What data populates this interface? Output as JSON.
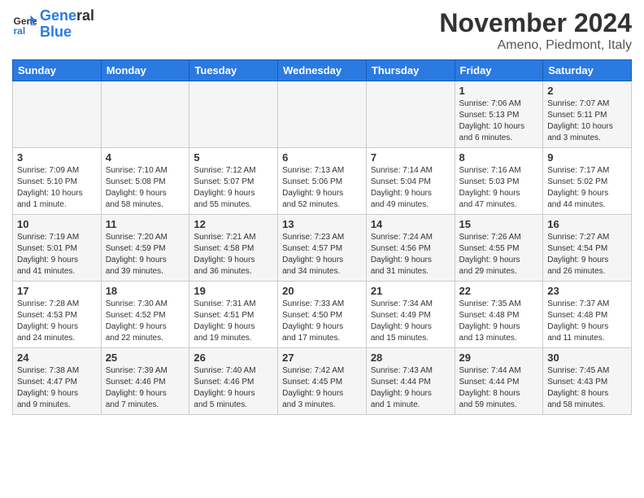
{
  "logo": {
    "line1": "General",
    "line2": "Blue"
  },
  "title": "November 2024",
  "location": "Ameno, Piedmont, Italy",
  "weekdays": [
    "Sunday",
    "Monday",
    "Tuesday",
    "Wednesday",
    "Thursday",
    "Friday",
    "Saturday"
  ],
  "rows": [
    [
      {
        "day": "",
        "info": ""
      },
      {
        "day": "",
        "info": ""
      },
      {
        "day": "",
        "info": ""
      },
      {
        "day": "",
        "info": ""
      },
      {
        "day": "",
        "info": ""
      },
      {
        "day": "1",
        "info": "Sunrise: 7:06 AM\nSunset: 5:13 PM\nDaylight: 10 hours\nand 6 minutes."
      },
      {
        "day": "2",
        "info": "Sunrise: 7:07 AM\nSunset: 5:11 PM\nDaylight: 10 hours\nand 3 minutes."
      }
    ],
    [
      {
        "day": "3",
        "info": "Sunrise: 7:09 AM\nSunset: 5:10 PM\nDaylight: 10 hours\nand 1 minute."
      },
      {
        "day": "4",
        "info": "Sunrise: 7:10 AM\nSunset: 5:08 PM\nDaylight: 9 hours\nand 58 minutes."
      },
      {
        "day": "5",
        "info": "Sunrise: 7:12 AM\nSunset: 5:07 PM\nDaylight: 9 hours\nand 55 minutes."
      },
      {
        "day": "6",
        "info": "Sunrise: 7:13 AM\nSunset: 5:06 PM\nDaylight: 9 hours\nand 52 minutes."
      },
      {
        "day": "7",
        "info": "Sunrise: 7:14 AM\nSunset: 5:04 PM\nDaylight: 9 hours\nand 49 minutes."
      },
      {
        "day": "8",
        "info": "Sunrise: 7:16 AM\nSunset: 5:03 PM\nDaylight: 9 hours\nand 47 minutes."
      },
      {
        "day": "9",
        "info": "Sunrise: 7:17 AM\nSunset: 5:02 PM\nDaylight: 9 hours\nand 44 minutes."
      }
    ],
    [
      {
        "day": "10",
        "info": "Sunrise: 7:19 AM\nSunset: 5:01 PM\nDaylight: 9 hours\nand 41 minutes."
      },
      {
        "day": "11",
        "info": "Sunrise: 7:20 AM\nSunset: 4:59 PM\nDaylight: 9 hours\nand 39 minutes."
      },
      {
        "day": "12",
        "info": "Sunrise: 7:21 AM\nSunset: 4:58 PM\nDaylight: 9 hours\nand 36 minutes."
      },
      {
        "day": "13",
        "info": "Sunrise: 7:23 AM\nSunset: 4:57 PM\nDaylight: 9 hours\nand 34 minutes."
      },
      {
        "day": "14",
        "info": "Sunrise: 7:24 AM\nSunset: 4:56 PM\nDaylight: 9 hours\nand 31 minutes."
      },
      {
        "day": "15",
        "info": "Sunrise: 7:26 AM\nSunset: 4:55 PM\nDaylight: 9 hours\nand 29 minutes."
      },
      {
        "day": "16",
        "info": "Sunrise: 7:27 AM\nSunset: 4:54 PM\nDaylight: 9 hours\nand 26 minutes."
      }
    ],
    [
      {
        "day": "17",
        "info": "Sunrise: 7:28 AM\nSunset: 4:53 PM\nDaylight: 9 hours\nand 24 minutes."
      },
      {
        "day": "18",
        "info": "Sunrise: 7:30 AM\nSunset: 4:52 PM\nDaylight: 9 hours\nand 22 minutes."
      },
      {
        "day": "19",
        "info": "Sunrise: 7:31 AM\nSunset: 4:51 PM\nDaylight: 9 hours\nand 19 minutes."
      },
      {
        "day": "20",
        "info": "Sunrise: 7:33 AM\nSunset: 4:50 PM\nDaylight: 9 hours\nand 17 minutes."
      },
      {
        "day": "21",
        "info": "Sunrise: 7:34 AM\nSunset: 4:49 PM\nDaylight: 9 hours\nand 15 minutes."
      },
      {
        "day": "22",
        "info": "Sunrise: 7:35 AM\nSunset: 4:48 PM\nDaylight: 9 hours\nand 13 minutes."
      },
      {
        "day": "23",
        "info": "Sunrise: 7:37 AM\nSunset: 4:48 PM\nDaylight: 9 hours\nand 11 minutes."
      }
    ],
    [
      {
        "day": "24",
        "info": "Sunrise: 7:38 AM\nSunset: 4:47 PM\nDaylight: 9 hours\nand 9 minutes."
      },
      {
        "day": "25",
        "info": "Sunrise: 7:39 AM\nSunset: 4:46 PM\nDaylight: 9 hours\nand 7 minutes."
      },
      {
        "day": "26",
        "info": "Sunrise: 7:40 AM\nSunset: 4:46 PM\nDaylight: 9 hours\nand 5 minutes."
      },
      {
        "day": "27",
        "info": "Sunrise: 7:42 AM\nSunset: 4:45 PM\nDaylight: 9 hours\nand 3 minutes."
      },
      {
        "day": "28",
        "info": "Sunrise: 7:43 AM\nSunset: 4:44 PM\nDaylight: 9 hours\nand 1 minute."
      },
      {
        "day": "29",
        "info": "Sunrise: 7:44 AM\nSunset: 4:44 PM\nDaylight: 8 hours\nand 59 minutes."
      },
      {
        "day": "30",
        "info": "Sunrise: 7:45 AM\nSunset: 4:43 PM\nDaylight: 8 hours\nand 58 minutes."
      }
    ]
  ]
}
